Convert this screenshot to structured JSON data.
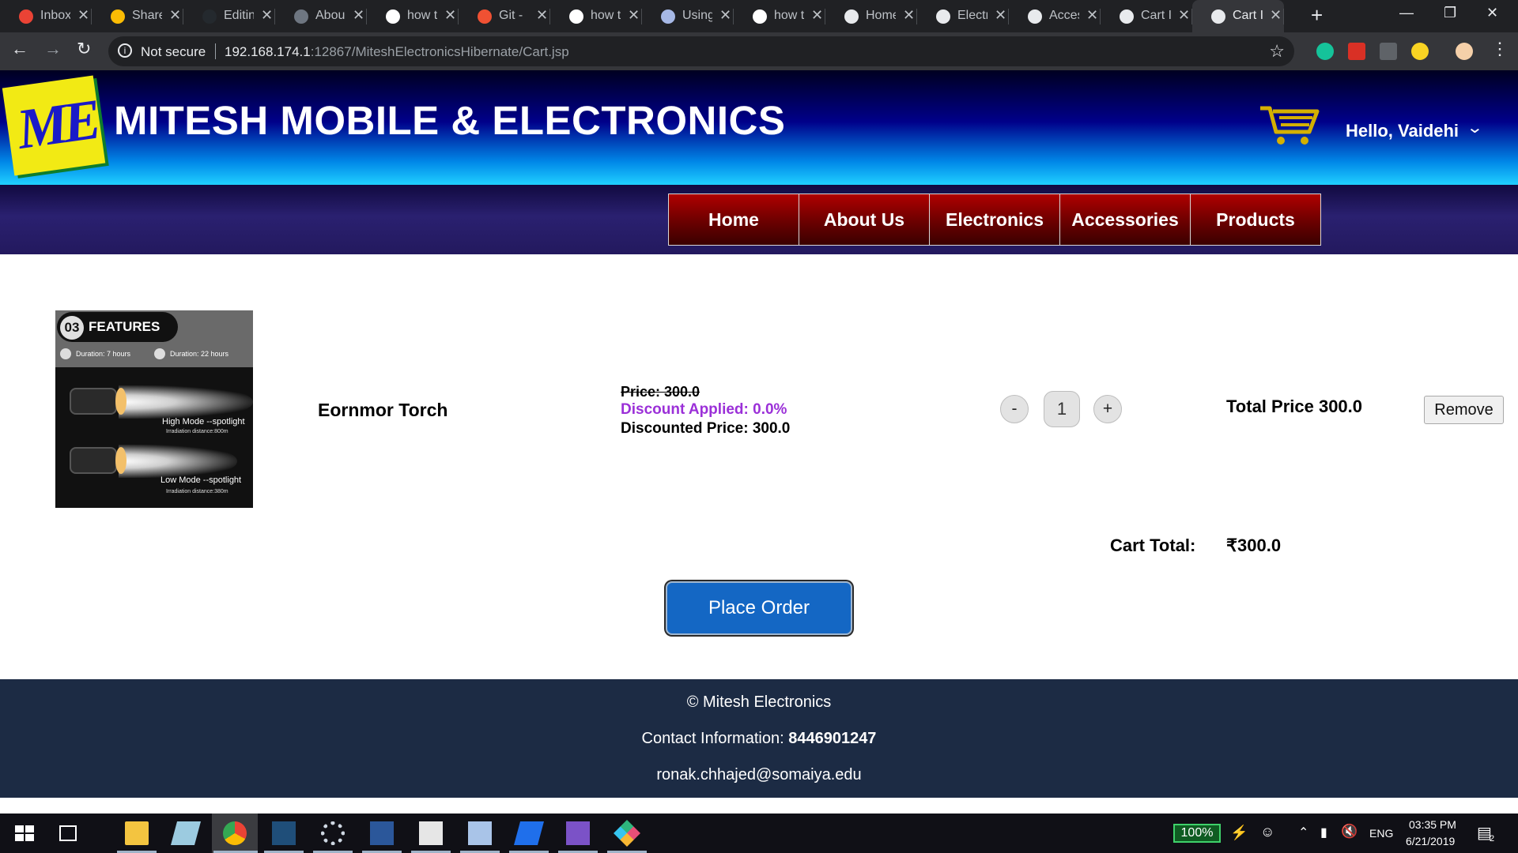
{
  "browser": {
    "tabs": [
      {
        "title": "Inbox",
        "icon": "gmail-icon",
        "color": "#ea4335"
      },
      {
        "title": "Share",
        "icon": "drive-icon",
        "color": "#fbbc04"
      },
      {
        "title": "Editin",
        "icon": "github-icon",
        "color": "#24292e"
      },
      {
        "title": "Abou",
        "icon": "github-icon",
        "color": "#6e7681"
      },
      {
        "title": "how t",
        "icon": "google-icon",
        "color": "#ffffff"
      },
      {
        "title": "Git - ",
        "icon": "git-icon",
        "color": "#f05133"
      },
      {
        "title": "how t",
        "icon": "google-icon",
        "color": "#ffffff"
      },
      {
        "title": "Using",
        "icon": "cube-icon",
        "color": "#a6b8e6"
      },
      {
        "title": "how t",
        "icon": "google-icon",
        "color": "#ffffff"
      },
      {
        "title": "Home",
        "icon": "globe-icon",
        "color": "#e8eaed"
      },
      {
        "title": "Electr",
        "icon": "globe-icon",
        "color": "#e8eaed"
      },
      {
        "title": "Acces",
        "icon": "globe-icon",
        "color": "#e8eaed"
      },
      {
        "title": "Cart I",
        "icon": "globe-icon",
        "color": "#e8eaed"
      },
      {
        "title": "Cart I",
        "icon": "globe-icon",
        "color": "#e8eaed"
      }
    ],
    "active_tab_index": 13,
    "new_tab_label": "+",
    "security_label": "Not secure",
    "url_host": "192.168.174.1",
    "url_rest": ":12867/MiteshElectronicsHibernate/Cart.jsp"
  },
  "site": {
    "logo_text": "ME",
    "brand": "MITESH MOBILE & ELECTRONICS",
    "greeting": "Hello, Vaidehi",
    "nav": [
      "Home",
      "About Us",
      "Electronics",
      "Accessories",
      "Products"
    ]
  },
  "product_image": {
    "badge_num": "03",
    "badge_text": "FEATURES",
    "duration_left": "Duration: 7 hours",
    "duration_right": "Duration: 22 hours",
    "mode_high": "High Mode --spotlight",
    "dist_high": "Irradiation distance:800m",
    "mode_low": "Low Mode --spotlight",
    "dist_low": "Irradiation distance:380m"
  },
  "cart": {
    "item": {
      "name": "Eornmor Torch",
      "price_line": "Price: 300.0",
      "discount_line": "Discount Applied: 0.0%",
      "discounted_line": "Discounted Price: 300.0",
      "quantity": "1",
      "minus_label": "-",
      "plus_label": "+",
      "total_line": "Total Price 300.0",
      "remove_label": "Remove"
    },
    "cart_total_label": "Cart Total:",
    "cart_total_value": "₹300.0",
    "place_order_label": "Place Order"
  },
  "footer": {
    "copyright": "© Mitesh Electronics",
    "contact_label": "Contact Information: ",
    "phone": "8446901247",
    "email": "ronak.chhajed@somaiya.edu"
  },
  "taskbar": {
    "battery": "100%",
    "lang": "ENG",
    "time": "03:35 PM",
    "date": "6/21/2019",
    "notif_count": "2"
  },
  "colors": {
    "nav_red": "#8b0000",
    "discount_purple": "#9b30d8",
    "button_blue": "#1467c4",
    "footer_bg": "#1c2b44"
  }
}
